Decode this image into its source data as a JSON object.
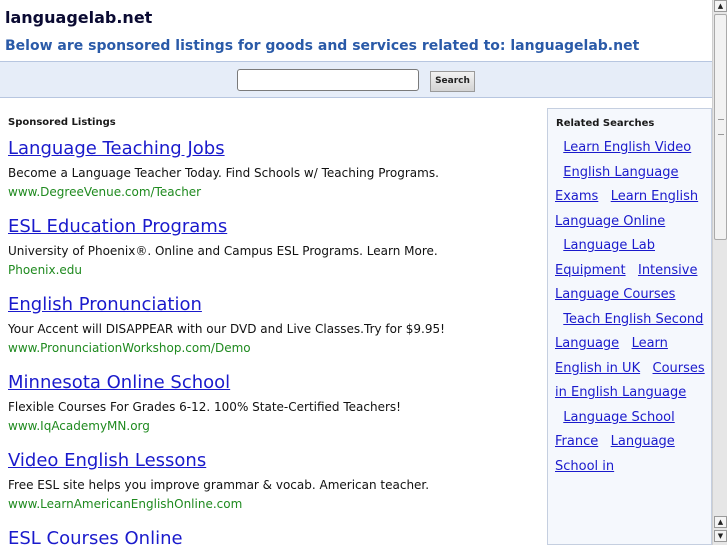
{
  "header": {
    "domain": "languagelab.net",
    "subtitle": "Below are sponsored listings for goods and services related to: languagelab.net"
  },
  "search": {
    "value": "",
    "placeholder": "",
    "button_label": "Search"
  },
  "listings": {
    "heading": "Sponsored Listings",
    "items": [
      {
        "title": "Language Teaching Jobs",
        "description": "Become a Language Teacher Today. Find Schools w/ Teaching Programs.",
        "url": "www.DegreeVenue.com/Teacher"
      },
      {
        "title": "ESL Education Programs",
        "description": "University of Phoenix®. Online and Campus ESL Programs. Learn More.",
        "url": "Phoenix.edu"
      },
      {
        "title": "English Pronunciation",
        "description": "Your Accent will DISAPPEAR with our DVD and Live Classes.Try for $9.95!",
        "url": "www.PronunciationWorkshop.com/Demo"
      },
      {
        "title": "Minnesota Online School",
        "description": "Flexible Courses For Grades 6-12. 100% State-Certified Teachers!",
        "url": "www.IqAcademyMN.org"
      },
      {
        "title": "Video English Lessons",
        "description": "Free ESL site helps you improve grammar & vocab. American teacher.",
        "url": "www.LearnAmericanEnglishOnline.com"
      },
      {
        "title": "ESL Courses Online",
        "description": "",
        "url": ""
      }
    ]
  },
  "related": {
    "heading": "Related Searches",
    "items": [
      "Learn English Video",
      "English Language Exams",
      "Learn English Language Online",
      "Language Lab Equipment",
      "Intensive Language Courses",
      "Teach English Second Language",
      "Learn English in UK",
      "Courses in English Language",
      "Language School France",
      "Language School in"
    ]
  },
  "scrollbar": {
    "up_icon": "arrow-up-icon",
    "down_icon": "arrow-down-icon"
  }
}
